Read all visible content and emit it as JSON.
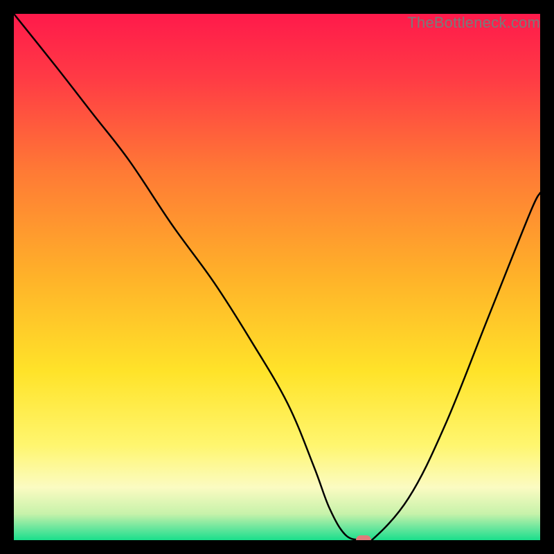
{
  "watermark": "TheBottleneck.com",
  "colors": {
    "frame_bg": "#000000",
    "curve_stroke": "#000000",
    "marker_fill": "#e07b7b",
    "gradient_stops": [
      {
        "pct": 0,
        "color": "#ff1a4b"
      },
      {
        "pct": 12,
        "color": "#ff3a45"
      },
      {
        "pct": 30,
        "color": "#ff7a35"
      },
      {
        "pct": 50,
        "color": "#ffb229"
      },
      {
        "pct": 68,
        "color": "#ffe329"
      },
      {
        "pct": 82,
        "color": "#fff66f"
      },
      {
        "pct": 90,
        "color": "#fbfbc2"
      },
      {
        "pct": 95,
        "color": "#c7f2aa"
      },
      {
        "pct": 98,
        "color": "#5fe59b"
      },
      {
        "pct": 100,
        "color": "#1adf8c"
      }
    ]
  },
  "chart_data": {
    "type": "line",
    "title": "",
    "xlabel": "",
    "ylabel": "",
    "xlim": [
      0,
      100
    ],
    "ylim": [
      0,
      100
    ],
    "series": [
      {
        "name": "bottleneck-curve",
        "x": [
          0,
          8,
          15,
          22,
          30,
          38,
          45,
          52,
          57,
          60,
          63,
          66,
          68,
          75,
          82,
          90,
          98,
          100
        ],
        "values": [
          100,
          90,
          81,
          72,
          60,
          49,
          38,
          26,
          14,
          6,
          1,
          0,
          0,
          8,
          22,
          42,
          62,
          66
        ]
      }
    ],
    "marker": {
      "x": 66.5,
      "y": 0
    }
  }
}
